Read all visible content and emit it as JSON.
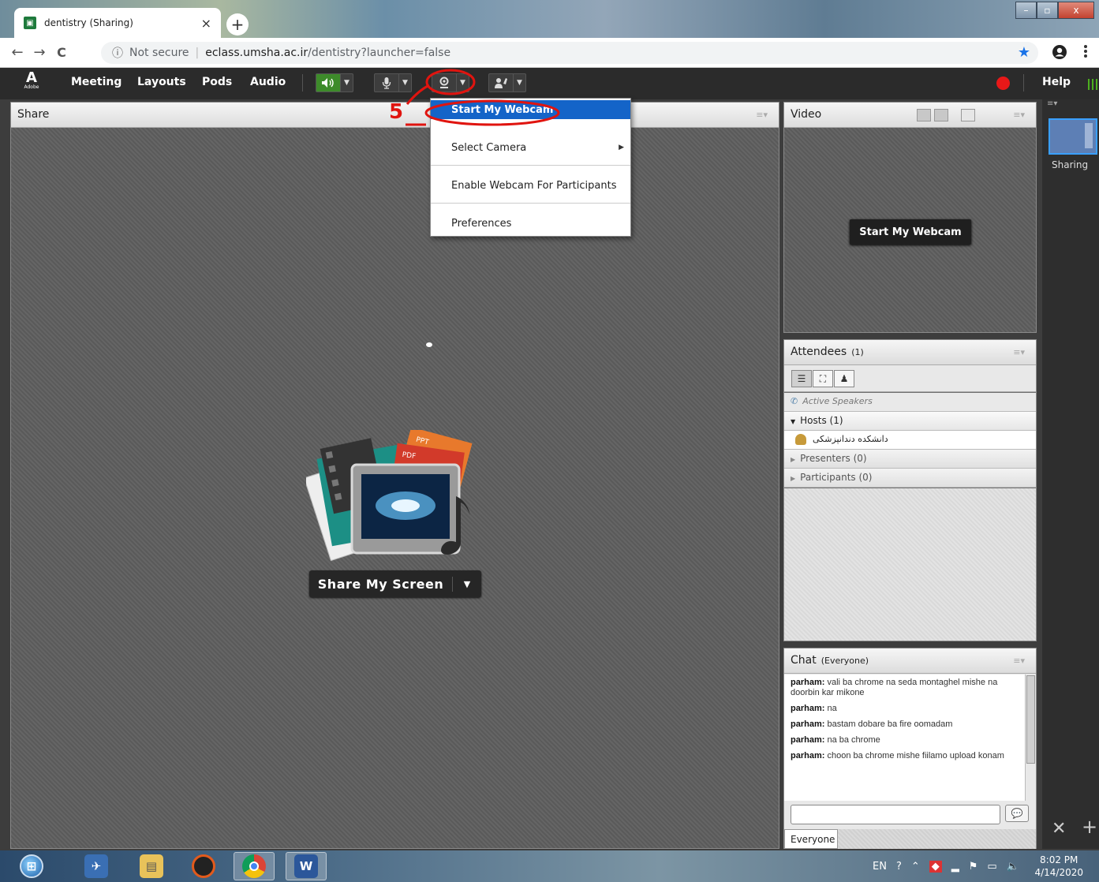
{
  "browser": {
    "tab_title": "dentistry (Sharing)",
    "tab_close": "×",
    "new_tab": "+",
    "nav_back": "←",
    "nav_forward": "→",
    "nav_reload": "C",
    "security_icon": "ⓘ",
    "security_text": "Not secure",
    "url_host": "eclass.umsha.ac.ir",
    "url_path": "/dentistry?launcher=false",
    "bookmark_icon": "★",
    "window_controls": {
      "minimize": "–",
      "maximize": "▫",
      "close": "x"
    }
  },
  "meeting": {
    "logo_text": "Adobe",
    "menus": [
      "Meeting",
      "Layouts",
      "Pods",
      "Audio"
    ],
    "help": "Help",
    "toolbar": {
      "speaker": "speaker-icon",
      "microphone": "microphone-icon",
      "webcam": "webcam-icon",
      "raise_hand": "raise-hand-icon"
    }
  },
  "webcam_menu": {
    "items": [
      "Start My Webcam",
      "Select Camera",
      "Enable Webcam For Participants",
      "Preferences"
    ],
    "selected": "Start My Webcam"
  },
  "annotation": {
    "label": "5",
    "color": "#e0140f"
  },
  "share_pod": {
    "title": "Share",
    "button_label": "Share My Screen",
    "art_labels": {
      "ppt": "PPT",
      "pdf": "PDF"
    }
  },
  "video_pod": {
    "title": "Video",
    "button_label": "Start My Webcam"
  },
  "attendees_pod": {
    "title": "Attendees",
    "count": "(1)",
    "active_speakers": "Active Speakers",
    "hosts": "Hosts (1)",
    "host_user": "دانشکده دندانپزشکی",
    "presenters": "Presenters (0)",
    "participants": "Participants (0)"
  },
  "chat_pod": {
    "title": "Chat",
    "scope": "(Everyone)",
    "messages": [
      {
        "sender": "parham:",
        "text": "vali ba chrome na seda montaghel mishe na doorbin kar mikone"
      },
      {
        "sender": "parham:",
        "text": "na"
      },
      {
        "sender": "parham:",
        "text": "bastam dobare ba fire oomadam"
      },
      {
        "sender": "parham:",
        "text": "na ba chrome"
      },
      {
        "sender": "parham:",
        "text": "choon ba chrome mishe fiilamo upload konam"
      }
    ],
    "tab": "Everyone"
  },
  "layouts_rail": {
    "items": [
      "Sharing"
    ]
  },
  "taskbar": {
    "language": "EN",
    "time": "8:02 PM",
    "date": "4/14/2020",
    "apps": [
      "windows-start",
      "thunderbird",
      "file-explorer",
      "media-app",
      "chrome",
      "word"
    ]
  },
  "colors": {
    "menubar": "#2b2b2b",
    "menu_highlight": "#1464c8",
    "record": "#e81818",
    "speaker_active": "#3d8b2a"
  }
}
